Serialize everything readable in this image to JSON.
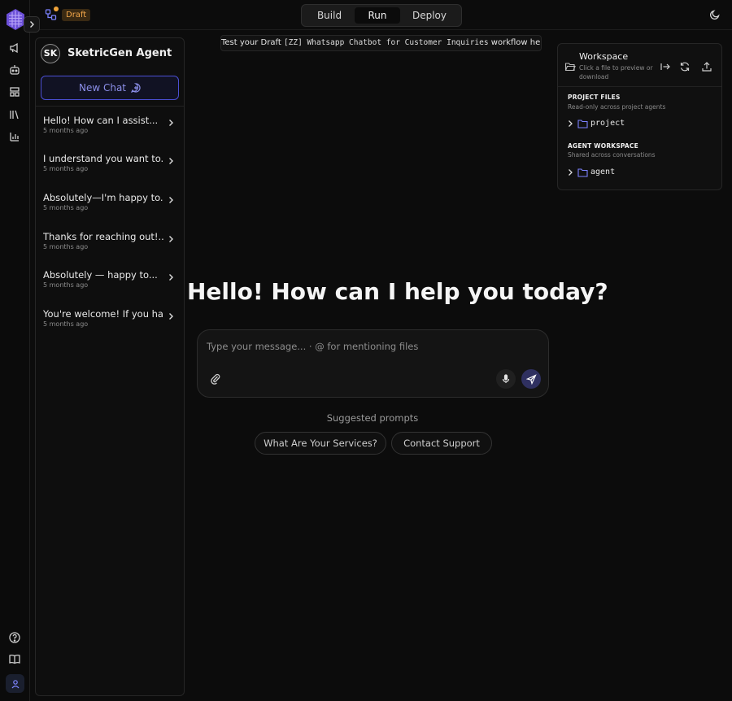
{
  "topbar": {
    "status_badge": "Draft",
    "modes": [
      {
        "label": "Build",
        "active": false
      },
      {
        "label": "Run",
        "active": true
      },
      {
        "label": "Deploy",
        "active": false
      }
    ]
  },
  "rail": {
    "icons": [
      "megaphone-icon",
      "bot-icon",
      "templates-icon",
      "library-icon",
      "analytics-icon"
    ],
    "bottom_icons": [
      "help-icon",
      "docs-icon",
      "user-icon"
    ]
  },
  "sidebar": {
    "agent_initials": "SK",
    "agent_name": "SketricGen Agent",
    "new_chat_label": "New Chat",
    "history": [
      {
        "title": "Hello! How can I assist...",
        "time": "5 months ago"
      },
      {
        "title": "I understand you want to...",
        "time": "5 months ago"
      },
      {
        "title": "Absolutely—I'm happy to...",
        "time": "5 months ago"
      },
      {
        "title": "Thanks for reaching out!...",
        "time": "5 months ago"
      },
      {
        "title": "Absolutely — happy to...",
        "time": "5 months ago"
      },
      {
        "title": "You're welcome! If you have...",
        "time": "5 months ago"
      }
    ]
  },
  "main": {
    "banner_prefix": "Test your Draft",
    "banner_workflow": "[ZZ] Whatsapp Chatbot for Customer Inquiries",
    "banner_suffix": "workflow here",
    "greeting": "Hello! How can I help you today?",
    "input_placeholder": "Type your message... · @ for mentioning files",
    "suggested_label": "Suggested prompts",
    "suggestions": [
      "What Are Your Services?",
      "Contact Support"
    ]
  },
  "workspace": {
    "title": "Workspace",
    "subtitle": "Click a file to preview or download",
    "project_section_title": "PROJECT FILES",
    "project_section_sub": "Read-only across project agents",
    "project_folder": "project",
    "agent_section_title": "AGENT WORKSPACE",
    "agent_section_sub": "Shared across conversations",
    "agent_folder": "agent"
  },
  "colors": {
    "accent": "#5b5fe8",
    "draft_badge_bg": "#3a2a13",
    "draft_badge_text": "#f1a64a",
    "background": "#0c0c0c"
  }
}
